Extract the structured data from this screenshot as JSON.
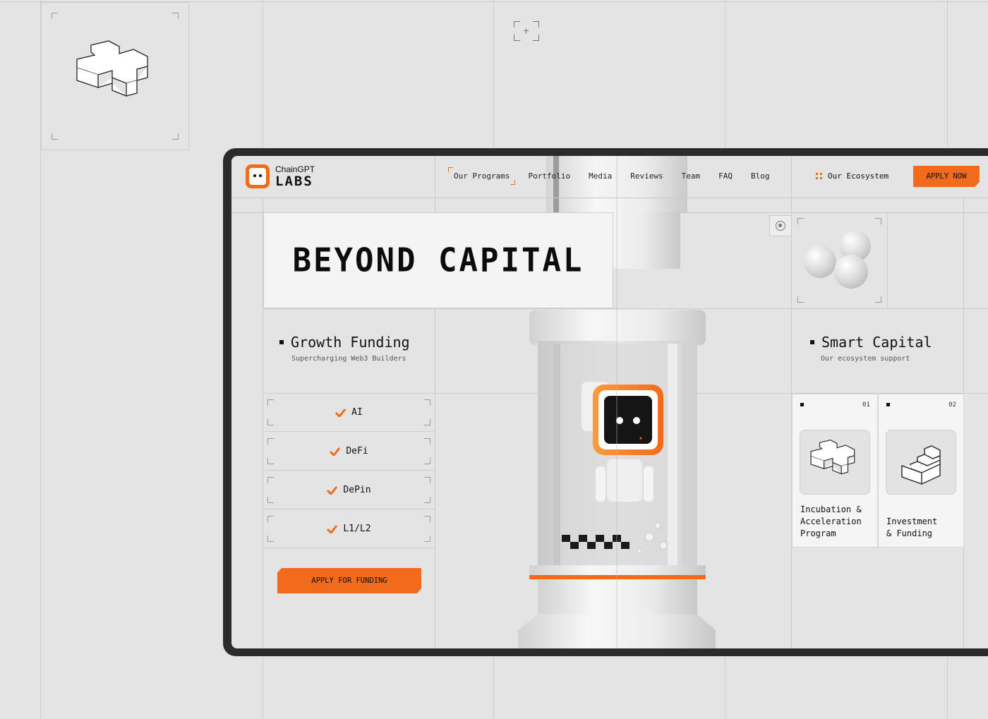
{
  "nav": {
    "logo_top": "ChainGPT",
    "logo_bottom": "LABS",
    "links": [
      "Our Programs",
      "Portfolio",
      "Media",
      "Reviews",
      "Team",
      "FAQ",
      "Blog"
    ],
    "ecosystem": "Our Ecosystem",
    "apply_now": "APPLY NOW"
  },
  "hero": {
    "title": "BEYOND CAPITAL"
  },
  "growth": {
    "heading": "Growth Funding",
    "sub": "Supercharging Web3 Builders",
    "categories": [
      "AI",
      "DeFi",
      "DePin",
      "L1/L2"
    ],
    "cta": "APPLY FOR FUNDING"
  },
  "smart": {
    "heading": "Smart Capital",
    "sub": "Our ecosystem support"
  },
  "programs": [
    {
      "number": "01",
      "title": "Incubation &\nAcceleration\nProgram"
    },
    {
      "number": "02",
      "title": "Investment\n& Funding"
    }
  ],
  "colors": {
    "accent": "#f26a1b",
    "frame": "#2b2b2b",
    "background": "#e4e4e4"
  }
}
